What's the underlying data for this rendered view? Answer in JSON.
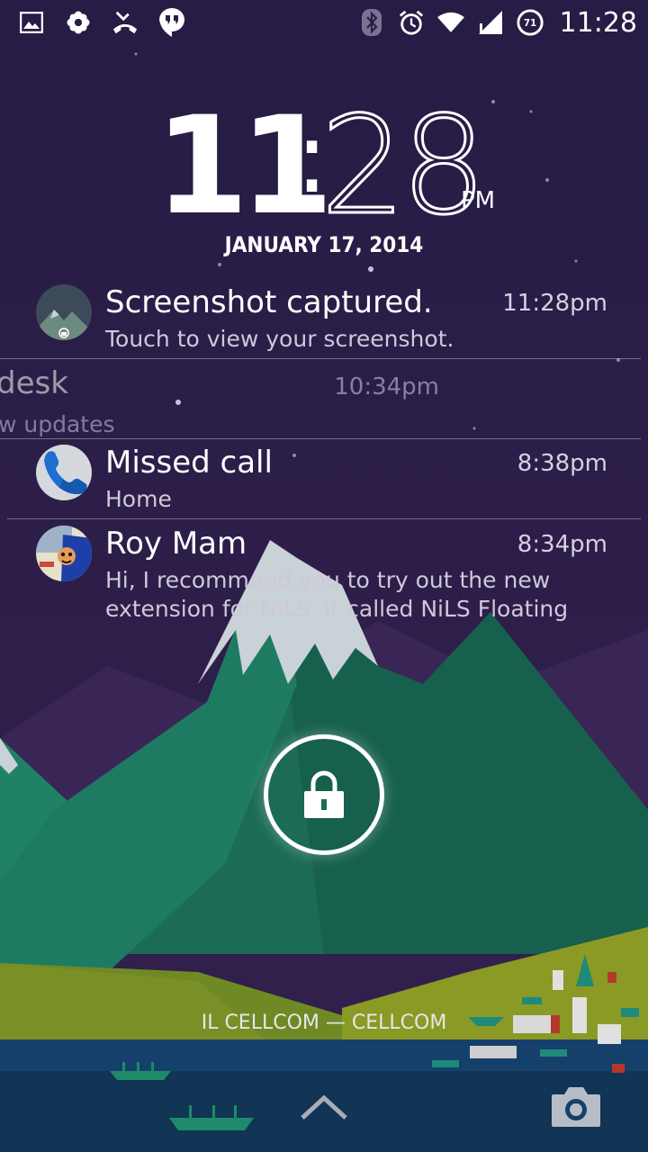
{
  "status_bar": {
    "left_icons": [
      "gallery-icon",
      "settings-flower-icon",
      "missed-call-icon",
      "hangouts-icon"
    ],
    "right_icons": [
      "bluetooth-icon",
      "alarm-icon",
      "wifi-icon",
      "cell-signal-icon",
      "battery-icon"
    ],
    "battery_level": "71",
    "time": "11:28"
  },
  "clock": {
    "hours": "11",
    "colon": ":",
    "minutes": "28",
    "ampm": "PM",
    "date": "JANUARY 17, 2014"
  },
  "notifications": [
    {
      "icon": "screenshot-thumbnail-icon",
      "title": "Screenshot captured.",
      "time": "11:28pm",
      "text": "Touch to view your screenshot."
    },
    {
      "icon": "",
      "title": "desk",
      "time": "10:34pm",
      "text": "w updates"
    },
    {
      "icon": "phone-icon",
      "title": "Missed call",
      "time": "8:38pm",
      "text": "Home"
    },
    {
      "icon": "contact-avatar-icon",
      "title": "Roy Mam",
      "time": "8:34pm",
      "text": "Hi, I recommend you to try out the new extension for NiLS, it called NiLS Floating"
    }
  ],
  "carrier": "IL CELLCOM — CELLCOM",
  "colors": {
    "sky": "#2a1e46",
    "mountain_green": "#1d7a5e",
    "snow": "#c9d2d6",
    "hill_olive": "#7a8a22",
    "water": "#153d6a"
  }
}
